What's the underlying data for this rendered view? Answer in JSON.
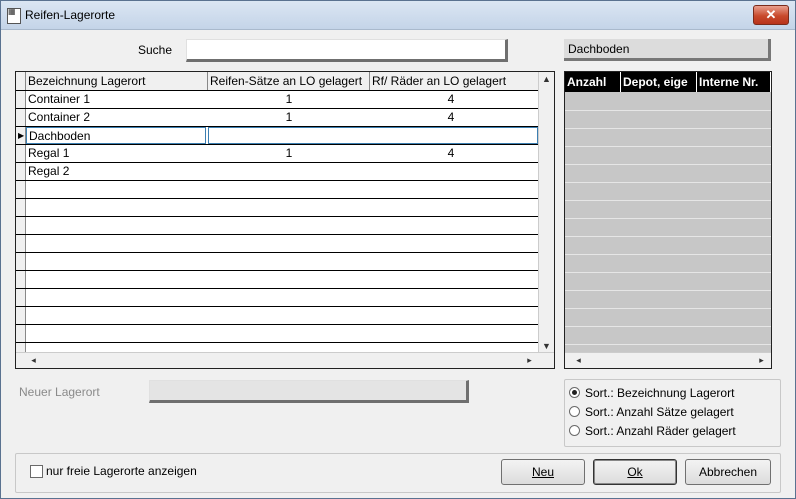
{
  "window": {
    "title": "Reifen-Lagerorte",
    "close_label": "✕"
  },
  "search": {
    "label": "Suche",
    "value": ""
  },
  "selected_location": "Dachboden",
  "grid": {
    "columns": [
      "Bezeichnung Lagerort",
      "Reifen-Sätze an LO gelagert",
      "Rf/ Räder an LO gelagert"
    ],
    "rows": [
      {
        "name": "Container 1",
        "sets": "1",
        "wheels": "4"
      },
      {
        "name": "Container 2",
        "sets": "1",
        "wheels": "4"
      },
      {
        "name": "Dachboden",
        "sets": "",
        "wheels": ""
      },
      {
        "name": "Regal 1",
        "sets": "1",
        "wheels": "4"
      },
      {
        "name": "Regal 2",
        "sets": "",
        "wheels": ""
      }
    ]
  },
  "detail_grid": {
    "columns": [
      "Anzahl",
      "Depot, eige",
      "Interne Nr."
    ]
  },
  "new_location": {
    "label": "Neuer Lagerort",
    "value": ""
  },
  "sort_options": [
    {
      "label": "Sort.: Bezeichnung Lagerort",
      "selected": true
    },
    {
      "label": "Sort.: Anzahl Sätze gelagert",
      "selected": false
    },
    {
      "label": "Sort.: Anzahl Räder gelagert",
      "selected": false
    }
  ],
  "filter": {
    "label": "nur freie Lagerorte anzeigen",
    "checked": false
  },
  "buttons": {
    "new": "Neu",
    "ok": "Ok",
    "cancel": "Abbrechen"
  },
  "colors": {
    "titlebar": "#c4d4e8",
    "close": "#c84a2c",
    "detail_header": "#000000"
  }
}
